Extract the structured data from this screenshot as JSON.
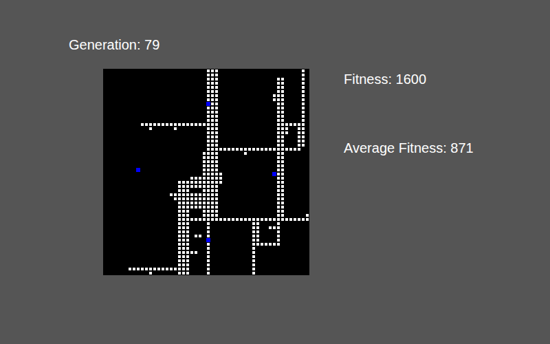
{
  "generation": "Generation: 79",
  "fitness": "Fitness: 1600",
  "average_fitness": "Average Fitness: 871",
  "grid": {
    "size": 50,
    "walls": [
      [
        25,
        0,
        27,
        24
      ],
      [
        24,
        20,
        24,
        24
      ],
      [
        9,
        13,
        24,
        13
      ],
      [
        11,
        14,
        11,
        14
      ],
      [
        17,
        14,
        17,
        14
      ],
      [
        28,
        19,
        47,
        19
      ],
      [
        34,
        20,
        34,
        20
      ],
      [
        42,
        2,
        43,
        36
      ],
      [
        41,
        6,
        41,
        7
      ],
      [
        48,
        0,
        48,
        18
      ],
      [
        44,
        13,
        47,
        13
      ],
      [
        47,
        14,
        47,
        18
      ],
      [
        44,
        14,
        44,
        15
      ],
      [
        24,
        25,
        27,
        36
      ],
      [
        21,
        26,
        23,
        28
      ],
      [
        18,
        27,
        20,
        49
      ],
      [
        19,
        30,
        26,
        33
      ],
      [
        17,
        31,
        24,
        31
      ],
      [
        16,
        30,
        17,
        30
      ],
      [
        28,
        25,
        28,
        27
      ],
      [
        22,
        40,
        23,
        40
      ],
      [
        19,
        36,
        49,
        36
      ],
      [
        49,
        35,
        49,
        35
      ],
      [
        25,
        37,
        25,
        49
      ],
      [
        36,
        37,
        36,
        49
      ],
      [
        37,
        37,
        37,
        42
      ],
      [
        38,
        42,
        42,
        42
      ],
      [
        42,
        37,
        42,
        42
      ],
      [
        40,
        38,
        41,
        38
      ],
      [
        6,
        48,
        17,
        48
      ],
      [
        11,
        49,
        11,
        49
      ],
      [
        21,
        44,
        22,
        44
      ]
    ],
    "agents": [
      [
        25,
        8,
        "#0000ff"
      ],
      [
        8,
        24,
        "#0000ff"
      ],
      [
        41,
        25,
        "#0000ff"
      ],
      [
        25,
        41,
        "#0000ff"
      ]
    ]
  }
}
